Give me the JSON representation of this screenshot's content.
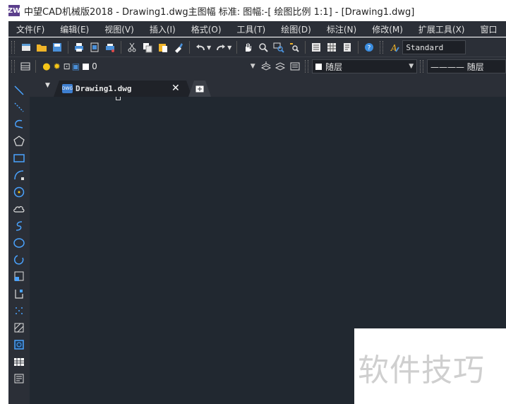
{
  "titlebar": {
    "title": "中望CAD机械版2018 - Drawing1.dwg主图幅  标准: 图幅:-[ 绘图比例 1:1] - [Drawing1.dwg]"
  },
  "menubar": {
    "items": [
      {
        "label": "文件(F)"
      },
      {
        "label": "编辑(E)"
      },
      {
        "label": "视图(V)"
      },
      {
        "label": "插入(I)"
      },
      {
        "label": "格式(O)"
      },
      {
        "label": "工具(T)"
      },
      {
        "label": "绘图(D)"
      },
      {
        "label": "标注(N)"
      },
      {
        "label": "修改(M)"
      },
      {
        "label": "扩展工具(X)"
      },
      {
        "label": "窗口"
      }
    ]
  },
  "toolbar": {
    "text_style_value": "Standard",
    "layer_value": "0",
    "color_value": "随层",
    "linetype_value": "———— 随层"
  },
  "document_tab": {
    "label": "Drawing1.dwg",
    "icon_text": "DWG"
  },
  "watermark": {
    "text": "软件技巧"
  },
  "colors": {
    "panel_bg": "#2b2f37",
    "canvas_bg": "#212830",
    "accent_blue": "#4aa3ff"
  }
}
